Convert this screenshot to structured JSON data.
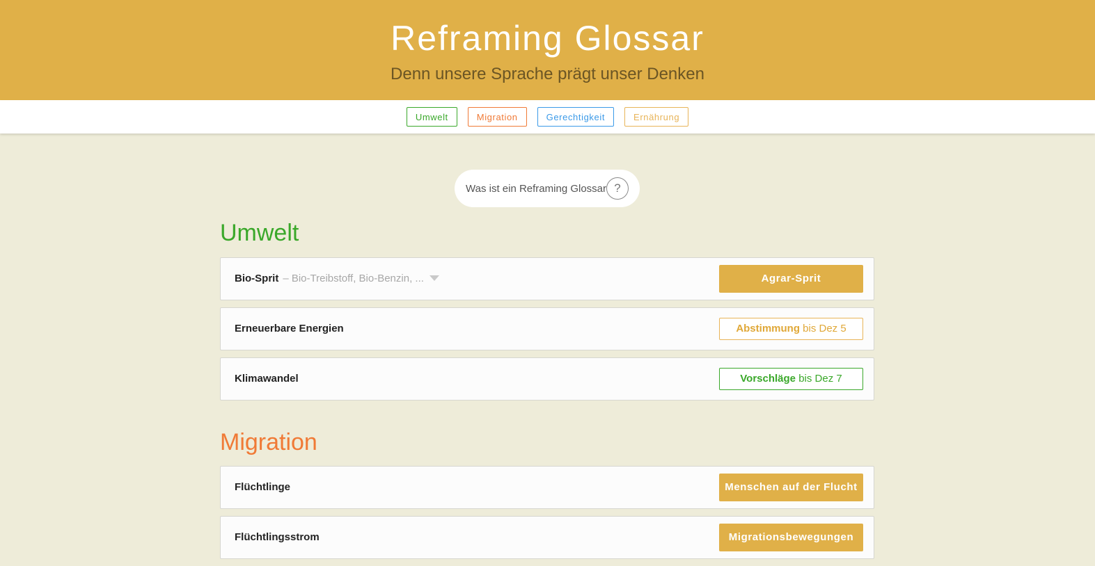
{
  "header": {
    "title": "Reframing Glossar",
    "subtitle": "Denn unsere Sprache prägt unser Denken"
  },
  "nav": {
    "items": [
      "Umwelt",
      "Migration",
      "Gerechtigkeit",
      "Ernährung"
    ]
  },
  "help": {
    "label": "Was ist ein Reframing Glossar",
    "icon_text": "?"
  },
  "colors": {
    "header": "#e0b048",
    "umwelt": "#3aa82a",
    "migration": "#f07a36",
    "gerechtigkeit": "#3b9ae8",
    "ernaehrung": "#e8b458",
    "background": "#eeecd9"
  },
  "sections": [
    {
      "title": "Umwelt",
      "rows": [
        {
          "term": "Bio-Sprit",
          "alts": "– Bio-Treibstoff, Bio-Benzin, ...",
          "action_label": "Agrar-Sprit"
        },
        {
          "term": "Erneuerbare Energien",
          "action_strong": "Abstimmung",
          "action_rest": " bis Dez 5"
        },
        {
          "term": "Klimawandel",
          "action_strong": "Vorschläge",
          "action_rest": " bis Dez 7"
        }
      ]
    },
    {
      "title": "Migration",
      "rows": [
        {
          "term": "Flüchtlinge",
          "action_label": "Menschen auf der Flucht"
        },
        {
          "term": "Flüchtlingsstrom",
          "action_label": "Migrationsbewegungen"
        }
      ]
    }
  ]
}
